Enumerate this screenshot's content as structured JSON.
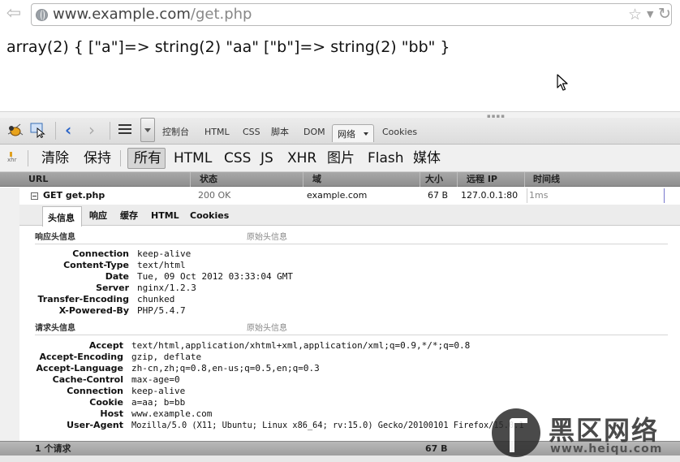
{
  "browser": {
    "url_host": "www.example.com",
    "url_path": "/get.php",
    "back_glyph": "⇦",
    "star_glyph": "☆",
    "refresh_glyph": "↻"
  },
  "page": {
    "output": "array(2) { [\"a\"]=> string(2) \"aa\" [\"b\"]=> string(2) \"bb\" }"
  },
  "firebug": {
    "tabs": [
      "控制台",
      "HTML",
      "CSS",
      "脚本",
      "DOM"
    ],
    "active_tab": "网络",
    "extra_tab": "Cookies",
    "filters": {
      "clear": "清除",
      "persist": "保持",
      "all": "所有",
      "types": [
        "HTML",
        "CSS",
        "JS",
        "XHR",
        "图片",
        "Flash",
        "媒体"
      ]
    },
    "columns": {
      "url": "URL",
      "status": "状态",
      "domain": "域",
      "size": "大小",
      "remote_ip": "远程 IP",
      "timeline": "时间线"
    },
    "request": {
      "label": "GET get.php",
      "status": "200 OK",
      "domain": "example.com",
      "size": "67 B",
      "remote_ip": "127.0.0.1:80",
      "time": "1ms"
    },
    "detail_tabs": {
      "headers": "头信息",
      "response": "响应",
      "cache": "缓存",
      "html": "HTML",
      "cookies": "Cookies"
    },
    "response_headers": {
      "title": "响应头信息",
      "raw": "原始头信息",
      "items": [
        {
          "k": "Connection",
          "v": "keep-alive"
        },
        {
          "k": "Content-Type",
          "v": "text/html"
        },
        {
          "k": "Date",
          "v": "Tue, 09 Oct 2012 03:33:04 GMT"
        },
        {
          "k": "Server",
          "v": "nginx/1.2.3"
        },
        {
          "k": "Transfer-Encoding",
          "v": "chunked"
        },
        {
          "k": "X-Powered-By",
          "v": "PHP/5.4.7"
        }
      ]
    },
    "request_headers": {
      "title": "请求头信息",
      "raw": "原始头信息",
      "items": [
        {
          "k": "Accept",
          "v": "text/html,application/xhtml+xml,application/xml;q=0.9,*/*;q=0.8"
        },
        {
          "k": "Accept-Encoding",
          "v": "gzip, deflate"
        },
        {
          "k": "Accept-Language",
          "v": "zh-cn,zh;q=0.8,en-us;q=0.5,en;q=0.3"
        },
        {
          "k": "Cache-Control",
          "v": "max-age=0"
        },
        {
          "k": "Connection",
          "v": "keep-alive"
        },
        {
          "k": "Cookie",
          "v": "a=aa; b=bb"
        },
        {
          "k": "Host",
          "v": "www.example.com"
        },
        {
          "k": "User-Agent",
          "v": "Mozilla/5.0 (X11; Ubuntu; Linux x86_64; rv:15.0) Gecko/20100101 Firefox/15.0.1"
        }
      ]
    },
    "footer": {
      "count": "1 个请求",
      "total_size": "67 B"
    }
  },
  "watermark": {
    "title": "黑区网络",
    "sub": "www.heiqu.com"
  }
}
